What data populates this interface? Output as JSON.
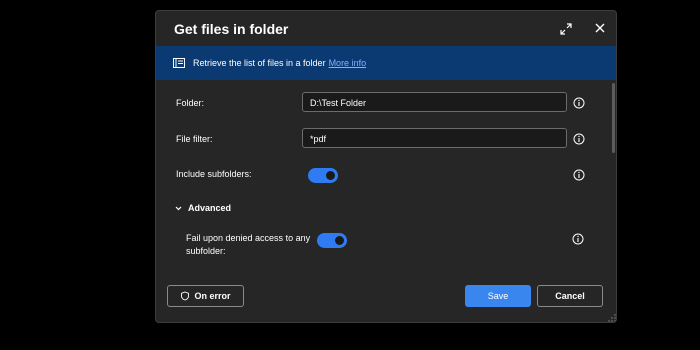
{
  "dialog": {
    "title": "Get files in folder",
    "banner": {
      "text": "Retrieve the list of files in a folder",
      "link": "More info"
    },
    "fields": {
      "folder": {
        "label": "Folder:",
        "value": "D:\\Test Folder"
      },
      "file_filter": {
        "label": "File filter:",
        "value": "*pdf"
      },
      "include_subfolders": {
        "label": "Include subfolders:",
        "on": true
      }
    },
    "advanced": {
      "label": "Advanced",
      "fail_on_denied": {
        "label_line1": "Fail upon denied access to any",
        "label_line2": "subfolder:",
        "on": true
      }
    },
    "buttons": {
      "on_error": "On error",
      "save": "Save",
      "cancel": "Cancel"
    },
    "colors": {
      "accent": "#3a86ef",
      "banner": "#0b3a73",
      "dialog_bg": "#262626"
    }
  }
}
